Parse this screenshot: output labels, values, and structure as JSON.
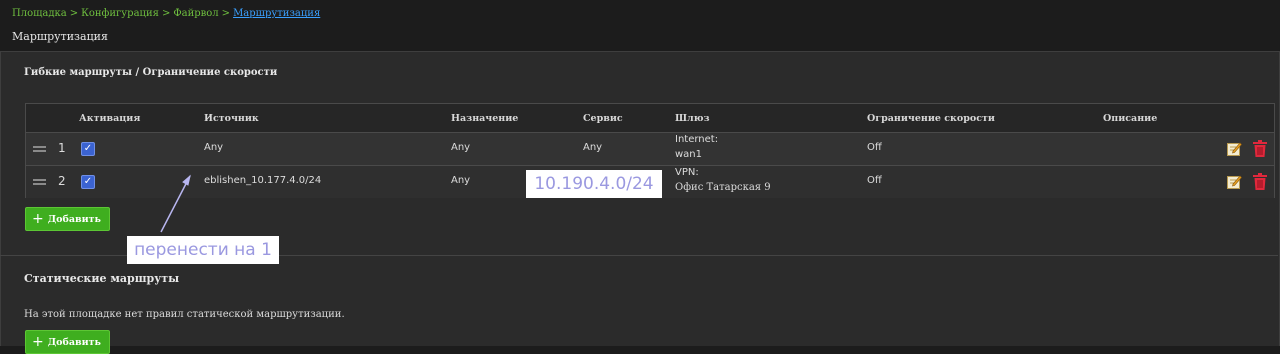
{
  "breadcrumb": {
    "items": [
      "Площадка",
      "Конфигурация",
      "Файрвол"
    ],
    "separator": ">",
    "current": "Маршрутизация"
  },
  "page_title": "Маршрутизация",
  "flex_routes": {
    "title": "Гибкие маршруты / Ограничение скорости",
    "columns": [
      "Активация",
      "Источник",
      "Назначение",
      "Сервис",
      "Шлюз",
      "Ограничение скорости",
      "Описание"
    ],
    "rows": [
      {
        "num": "1",
        "active": true,
        "source": "Any",
        "destination": "Any",
        "service": "Any",
        "gateway_line1": "Internet:",
        "gateway_line2": "wan1",
        "speed_limit": "Off",
        "description": ""
      },
      {
        "num": "2",
        "active": true,
        "source": "eblishen_10.177.4.0/24",
        "destination": "Any",
        "service": "",
        "gateway_line1": "VPN:",
        "gateway_line2": "Офис Татарская 9",
        "speed_limit": "Off",
        "description": ""
      }
    ],
    "add_label": "Добавить"
  },
  "static_routes": {
    "title": "Статические маршруты",
    "empty_text": "На этой площадке нет правил статической маршрутизации.",
    "add_label": "Добавить"
  },
  "annotations": {
    "ip_note": "10.190.4.0/24",
    "move_note": "перенести на 1"
  },
  "colors": {
    "accent_green": "#3fae1f",
    "breadcrumb_green": "#6fbf3f",
    "link_blue": "#3aa0ff",
    "checkbox_blue": "#3b63d1",
    "delete_red": "#e0283c",
    "annotation_text": "#9a98e0"
  }
}
